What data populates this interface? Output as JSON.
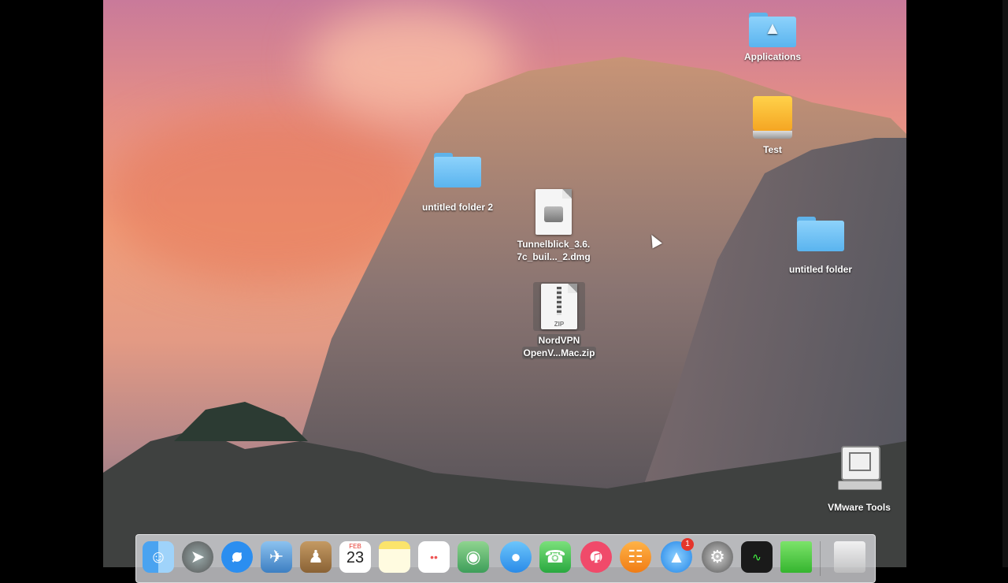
{
  "desktop": {
    "icons": [
      {
        "label": "Applications",
        "type": "app-folder"
      },
      {
        "label": "Test",
        "type": "drive"
      },
      {
        "label": "untitled folder 2",
        "type": "folder"
      },
      {
        "label_line1": "Tunnelblick_3.6.",
        "label_line2": "7c_buil..._2.dmg",
        "type": "dmg"
      },
      {
        "label": "untitled folder",
        "type": "folder"
      },
      {
        "label_line1": "NordVPN",
        "label_line2": "OpenV...Mac.zip",
        "type": "zip",
        "zip_text": "ZIP"
      },
      {
        "label": "VMware Tools",
        "type": "vmware"
      }
    ]
  },
  "dock": {
    "calendar_month": "FEB",
    "calendar_day": "23",
    "appstore_badge": "1"
  },
  "colors": {
    "folder_blue": "#5ab4ef",
    "drive_orange": "#f5a623",
    "badge_red": "#e5352b"
  }
}
